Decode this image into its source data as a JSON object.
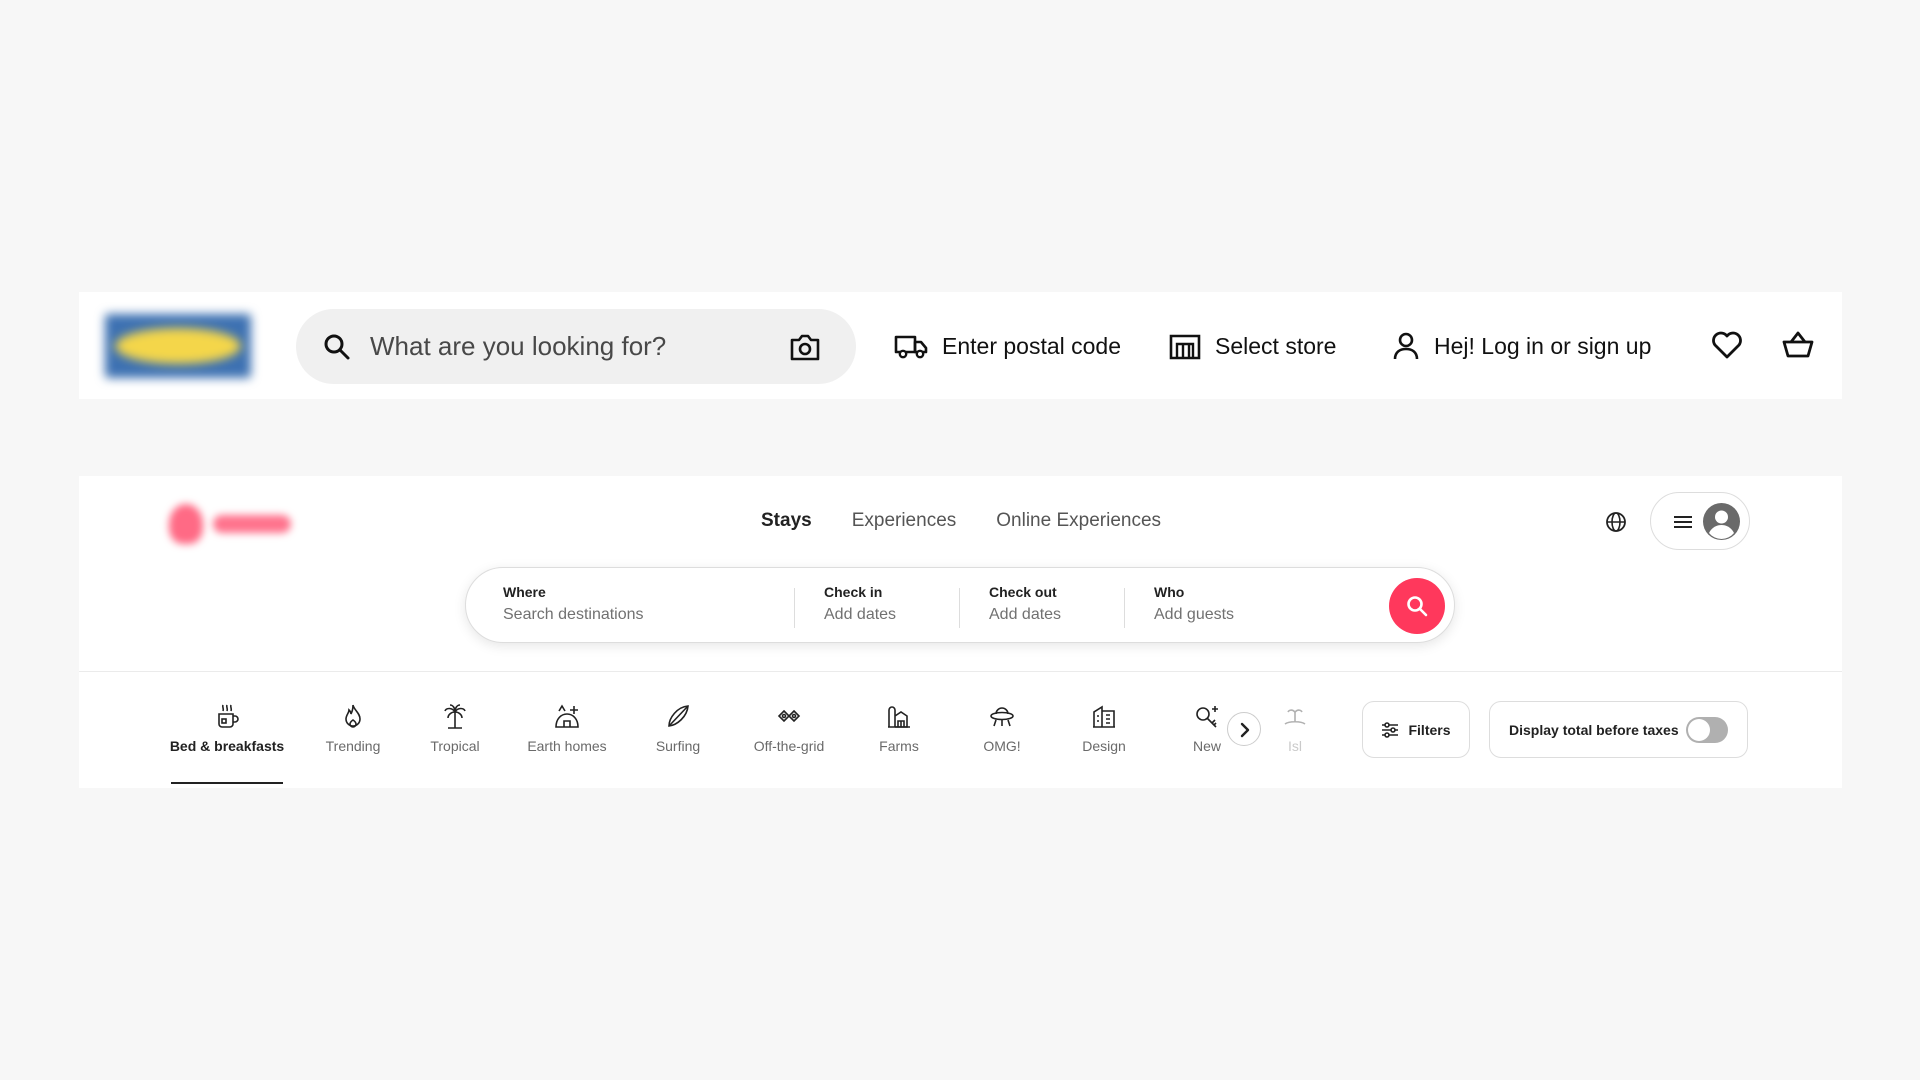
{
  "ikea": {
    "search": {
      "placeholder": "What are you looking for?"
    },
    "postal_label": "Enter postal code",
    "store_label": "Select store",
    "login_label": "Hej! Log in or sign up"
  },
  "airbnb": {
    "tabs": [
      "Stays",
      "Experiences",
      "Online Experiences"
    ],
    "search": {
      "where_label": "Where",
      "where_value": "Search destinations",
      "checkin_label": "Check in",
      "checkin_value": "Add dates",
      "checkout_label": "Check out",
      "checkout_value": "Add dates",
      "who_label": "Who",
      "who_value": "Add guests"
    },
    "categories": [
      "Bed & breakfasts",
      "Trending",
      "Tropical",
      "Earth homes",
      "Surfing",
      "Off-the-grid",
      "Farms",
      "OMG!",
      "Design",
      "New",
      "Isl"
    ],
    "filters_label": "Filters",
    "taxes_label": "Display total before taxes",
    "accent_color": "#ff385c"
  }
}
